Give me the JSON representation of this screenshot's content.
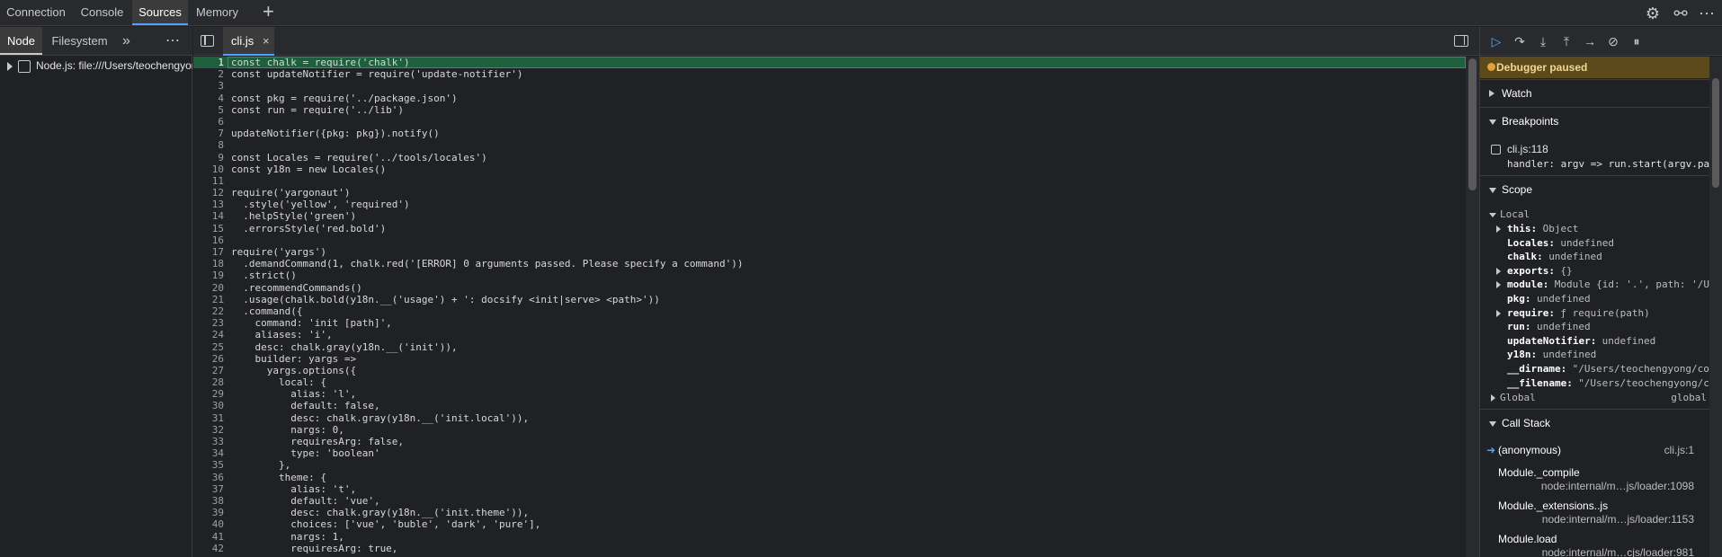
{
  "top_tabs": [
    "Connection",
    "Console",
    "Sources",
    "Memory"
  ],
  "navigator": {
    "tabs": [
      "Node",
      "Filesystem"
    ],
    "tree_item": "Node.js: file:///Users/teochengyong/docsify-cli"
  },
  "editor": {
    "file_tab": "cli.js",
    "close_glyph": "×",
    "lines": [
      {
        "n": "1",
        "text": "const chalk = require('chalk')"
      },
      {
        "n": "2",
        "text": "const updateNotifier = require('update-notifier')"
      },
      {
        "n": "3",
        "text": ""
      },
      {
        "n": "4",
        "text": "const pkg = require('../package.json')"
      },
      {
        "n": "5",
        "text": "const run = require('../lib')"
      },
      {
        "n": "6",
        "text": ""
      },
      {
        "n": "7",
        "text": "updateNotifier({pkg: pkg}).notify()"
      },
      {
        "n": "8",
        "text": ""
      },
      {
        "n": "9",
        "text": "const Locales = require('../tools/locales')"
      },
      {
        "n": "10",
        "text": "const y18n = new Locales()"
      },
      {
        "n": "11",
        "text": ""
      },
      {
        "n": "12",
        "text": "require('yargonaut')"
      },
      {
        "n": "13",
        "text": "  .style('yellow', 'required')"
      },
      {
        "n": "14",
        "text": "  .helpStyle('green')"
      },
      {
        "n": "15",
        "text": "  .errorsStyle('red.bold')"
      },
      {
        "n": "16",
        "text": ""
      },
      {
        "n": "17",
        "text": "require('yargs')"
      },
      {
        "n": "18",
        "text": "  .demandCommand(1, chalk.red('[ERROR] 0 arguments passed. Please specify a command'))"
      },
      {
        "n": "19",
        "text": "  .strict()"
      },
      {
        "n": "20",
        "text": "  .recommendCommands()"
      },
      {
        "n": "21",
        "text": "  .usage(chalk.bold(y18n.__('usage') + ': docsify <init|serve> <path>'))"
      },
      {
        "n": "22",
        "text": "  .command({"
      },
      {
        "n": "23",
        "text": "    command: 'init [path]',"
      },
      {
        "n": "24",
        "text": "    aliases: 'i',"
      },
      {
        "n": "25",
        "text": "    desc: chalk.gray(y18n.__('init')),"
      },
      {
        "n": "26",
        "text": "    builder: yargs =>"
      },
      {
        "n": "27",
        "text": "      yargs.options({"
      },
      {
        "n": "28",
        "text": "        local: {"
      },
      {
        "n": "29",
        "text": "          alias: 'l',"
      },
      {
        "n": "30",
        "text": "          default: false,"
      },
      {
        "n": "31",
        "text": "          desc: chalk.gray(y18n.__('init.local')),"
      },
      {
        "n": "32",
        "text": "          nargs: 0,"
      },
      {
        "n": "33",
        "text": "          requiresArg: false,"
      },
      {
        "n": "34",
        "text": "          type: 'boolean'"
      },
      {
        "n": "35",
        "text": "        },"
      },
      {
        "n": "36",
        "text": "        theme: {"
      },
      {
        "n": "37",
        "text": "          alias: 't',"
      },
      {
        "n": "38",
        "text": "          default: 'vue',"
      },
      {
        "n": "39",
        "text": "          desc: chalk.gray(y18n.__('init.theme')),"
      },
      {
        "n": "40",
        "text": "          choices: ['vue', 'buble', 'dark', 'pure'],"
      },
      {
        "n": "41",
        "text": "          nargs: 1,"
      },
      {
        "n": "42",
        "text": "          requiresArg: true,"
      }
    ]
  },
  "debugger": {
    "paused_label": "Debugger paused",
    "sections": {
      "watch": "Watch",
      "breakpoints": "Breakpoints",
      "scope": "Scope",
      "call_stack": "Call Stack"
    },
    "breakpoint": {
      "location": "cli.js:118",
      "code": "handler: argv => run.start(argv.path, argv"
    },
    "scope_local_label": "Local",
    "scope_global_label": "Global",
    "scope_global_value": "global",
    "scope_vars": [
      {
        "key": "this:",
        "value": "Object"
      },
      {
        "key": "Locales:",
        "value": "undefined"
      },
      {
        "key": "chalk:",
        "value": "undefined"
      },
      {
        "key": "exports:",
        "value": "{}"
      },
      {
        "key": "module:",
        "value": "Module {id: '.', path: '/Users/teochengyong"
      },
      {
        "key": "pkg:",
        "value": "undefined"
      },
      {
        "key": "require:",
        "value": "ƒ require(path)"
      },
      {
        "key": "run:",
        "value": "undefined"
      },
      {
        "key": "updateNotifier:",
        "value": "undefined"
      },
      {
        "key": "y18n:",
        "value": "undefined"
      },
      {
        "key": "__dirname:",
        "value": "\"/Users/teochengyong/code/docsify-cli\""
      },
      {
        "key": "__filename:",
        "value": "\"/Users/teochengyong/code/docsify-cli/bin\""
      }
    ],
    "call_stack": [
      {
        "fn": "(anonymous)",
        "loc": "cli.js:1",
        "loc2": ""
      },
      {
        "fn": "Module._compile",
        "loc": "",
        "loc2": "node:internal/m…js/loader:1098"
      },
      {
        "fn": "Module._extensions..js",
        "loc": "",
        "loc2": "node:internal/m…js/loader:1153"
      },
      {
        "fn": "Module.load",
        "loc": "",
        "loc2": "node:internal/m…cjs/loader:981"
      }
    ]
  }
}
